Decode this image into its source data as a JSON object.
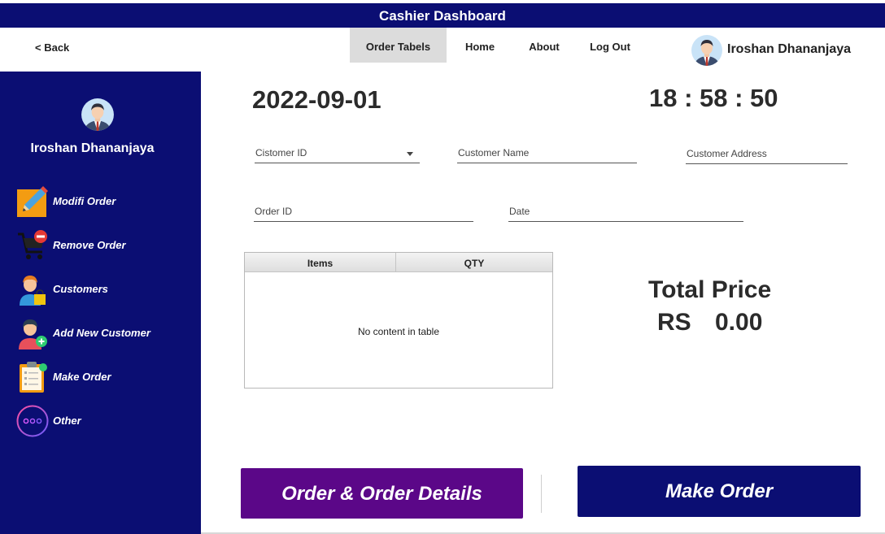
{
  "window": {
    "title": "Cashier Dashboard"
  },
  "topnav": {
    "back": "< Back",
    "items": [
      {
        "label": "Order Tabels",
        "active": true
      },
      {
        "label": "Home",
        "active": false
      },
      {
        "label": "About",
        "active": false
      },
      {
        "label": "Log Out",
        "active": false
      }
    ],
    "user_name": "Iroshan Dhananjaya"
  },
  "sidebar": {
    "user_name": "Iroshan Dhananjaya",
    "items": [
      {
        "label": "Modifi Order",
        "icon": "pencil-icon"
      },
      {
        "label": "Remove Order",
        "icon": "cart-remove-icon"
      },
      {
        "label": "Customers",
        "icon": "customers-icon"
      },
      {
        "label": "Add New Customer",
        "icon": "add-user-icon"
      },
      {
        "label": "Make Order",
        "icon": "clipboard-icon"
      },
      {
        "label": "Other",
        "icon": "more-icon"
      }
    ]
  },
  "main": {
    "date": "2022-09-01",
    "time": "18 : 58 : 50",
    "fields": {
      "customer_id": "Cistomer ID",
      "customer_name": "Customer Name",
      "customer_address": "Customer Address",
      "order_id": "Order ID",
      "date": "Date"
    },
    "table": {
      "columns": [
        "Items",
        "QTY"
      ],
      "empty_text": "No content in table"
    },
    "total": {
      "title": "Total Price",
      "currency": "RS",
      "value": "0.00"
    },
    "buttons": {
      "details": "Order & Order Details",
      "make": "Make Order"
    }
  },
  "colors": {
    "navy": "#0b0e73",
    "purple": "#5b0788",
    "active_tab": "#dcdcdc"
  }
}
